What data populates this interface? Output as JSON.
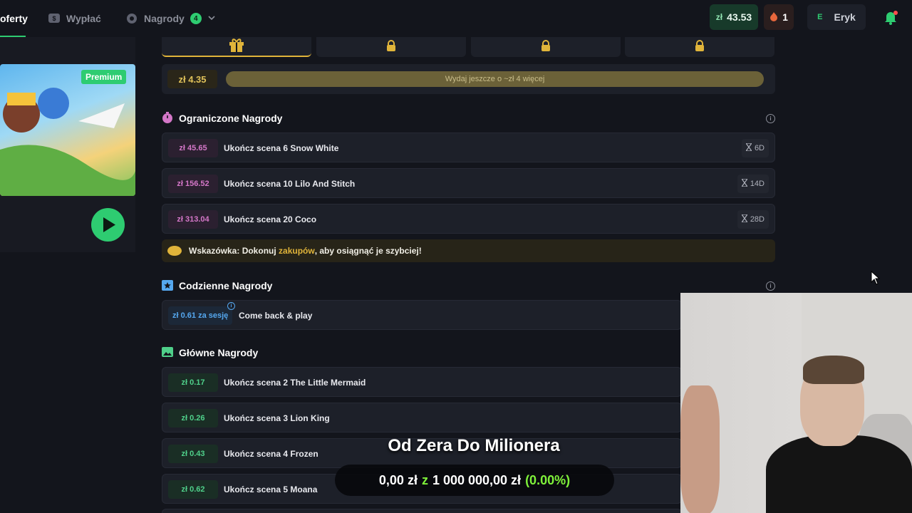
{
  "nav": {
    "items": [
      {
        "label": "oferty"
      },
      {
        "label": "Wypłać"
      },
      {
        "label": "Nagrody",
        "badge": "4"
      }
    ],
    "balance": {
      "currency": "zł",
      "amount": "43.53"
    },
    "streak": "1",
    "user": {
      "initial": "E",
      "name": "Eryk"
    }
  },
  "game_card": {
    "badge": "Premium"
  },
  "progress": {
    "amount": "zł 4.35",
    "message": "Wydaj jeszcze o ~zł 4 więcej"
  },
  "limited": {
    "title": "Ograniczone Nagrody",
    "rows": [
      {
        "amount": "zł 45.65",
        "label": "Ukończ scena 6 Snow White",
        "timer": "6D"
      },
      {
        "amount": "zł 156.52",
        "label": "Ukończ scena 10 Lilo And Stitch",
        "timer": "14D"
      },
      {
        "amount": "zł 313.04",
        "label": "Ukończ scena 20 Coco",
        "timer": "28D"
      }
    ]
  },
  "tip": {
    "prefix": "Wskazówka: Dokonuj ",
    "link": "zakupów",
    "suffix": ", aby osiągnąć je szybciej!"
  },
  "daily": {
    "title": "Codzienne Nagrody",
    "row": {
      "amount": "zł 0.61 za sesję",
      "label": "Come back & play"
    }
  },
  "main": {
    "title": "Główne Nagrody",
    "rows": [
      {
        "amount": "zł 0.17",
        "label": "Ukończ scena 2 The Little Mermaid"
      },
      {
        "amount": "zł 0.26",
        "label": "Ukończ scena 3 Lion King"
      },
      {
        "amount": "zł 0.43",
        "label": "Ukończ scena 4 Frozen"
      },
      {
        "amount": "zł 0.62",
        "label": "Ukończ scena 5 Moana"
      }
    ]
  },
  "overlay": {
    "title": "Od Zera Do Milionera",
    "current": "0,00 zł",
    "z": "z",
    "goal": "1 000 000,00 zł",
    "percent": "(0.00%)"
  },
  "colors": {
    "accent": "#2ecc71",
    "gold": "#e0b43a",
    "pink": "#d477c8"
  }
}
